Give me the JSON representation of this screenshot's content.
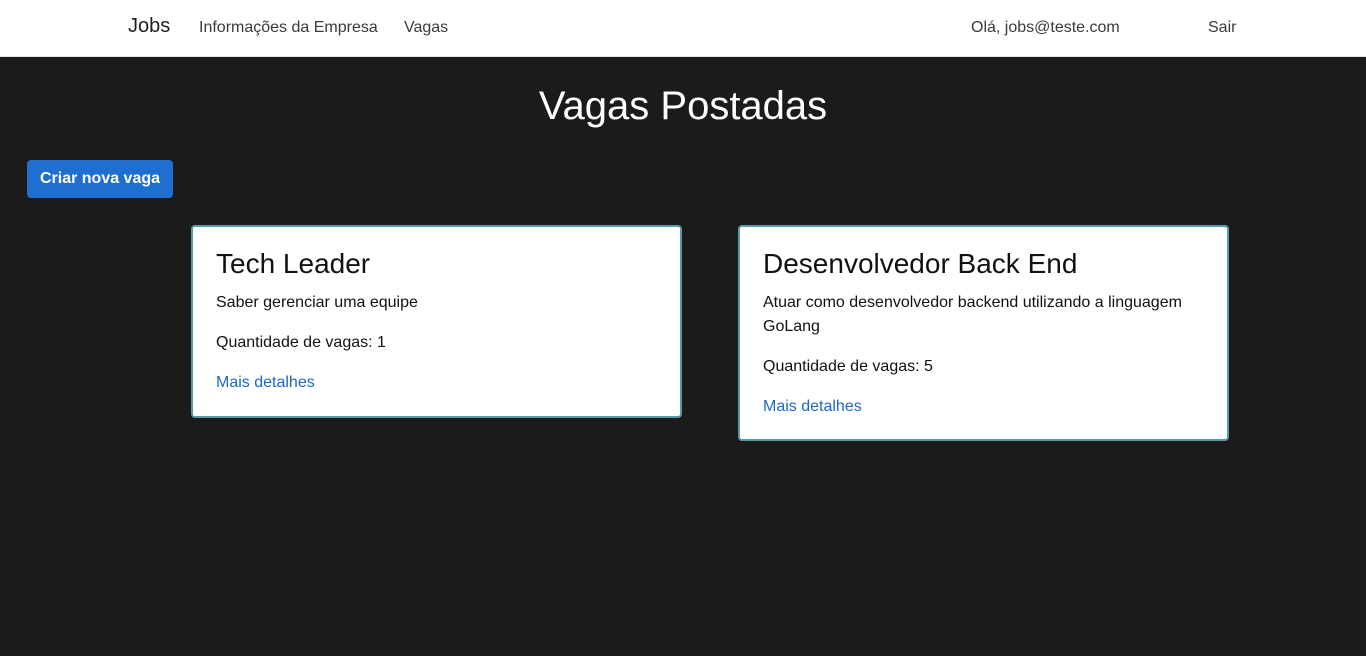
{
  "navbar": {
    "brand": "Jobs",
    "links": {
      "company": "Informações da Empresa",
      "jobs": "Vagas"
    },
    "greeting": "Olá, jobs@teste.com",
    "logout": "Sair"
  },
  "main": {
    "title": "Vagas Postadas",
    "create_button": "Criar nova vaga",
    "quantity_label": "Quantidade de vagas: ",
    "details_link": "Mais detalhes",
    "jobs": [
      {
        "title": "Tech Leader",
        "description": "Saber gerenciar uma equipe",
        "quantity": "1"
      },
      {
        "title": "Desenvolvedor Back End",
        "description": "Atuar como desenvolvedor backend utilizando a linguagem GoLang",
        "quantity": "5"
      }
    ]
  },
  "colors": {
    "background": "#1c1b1c",
    "primary": "#1f6fd1",
    "card_border": "#5b9aa4",
    "link": "#1f66c7"
  }
}
